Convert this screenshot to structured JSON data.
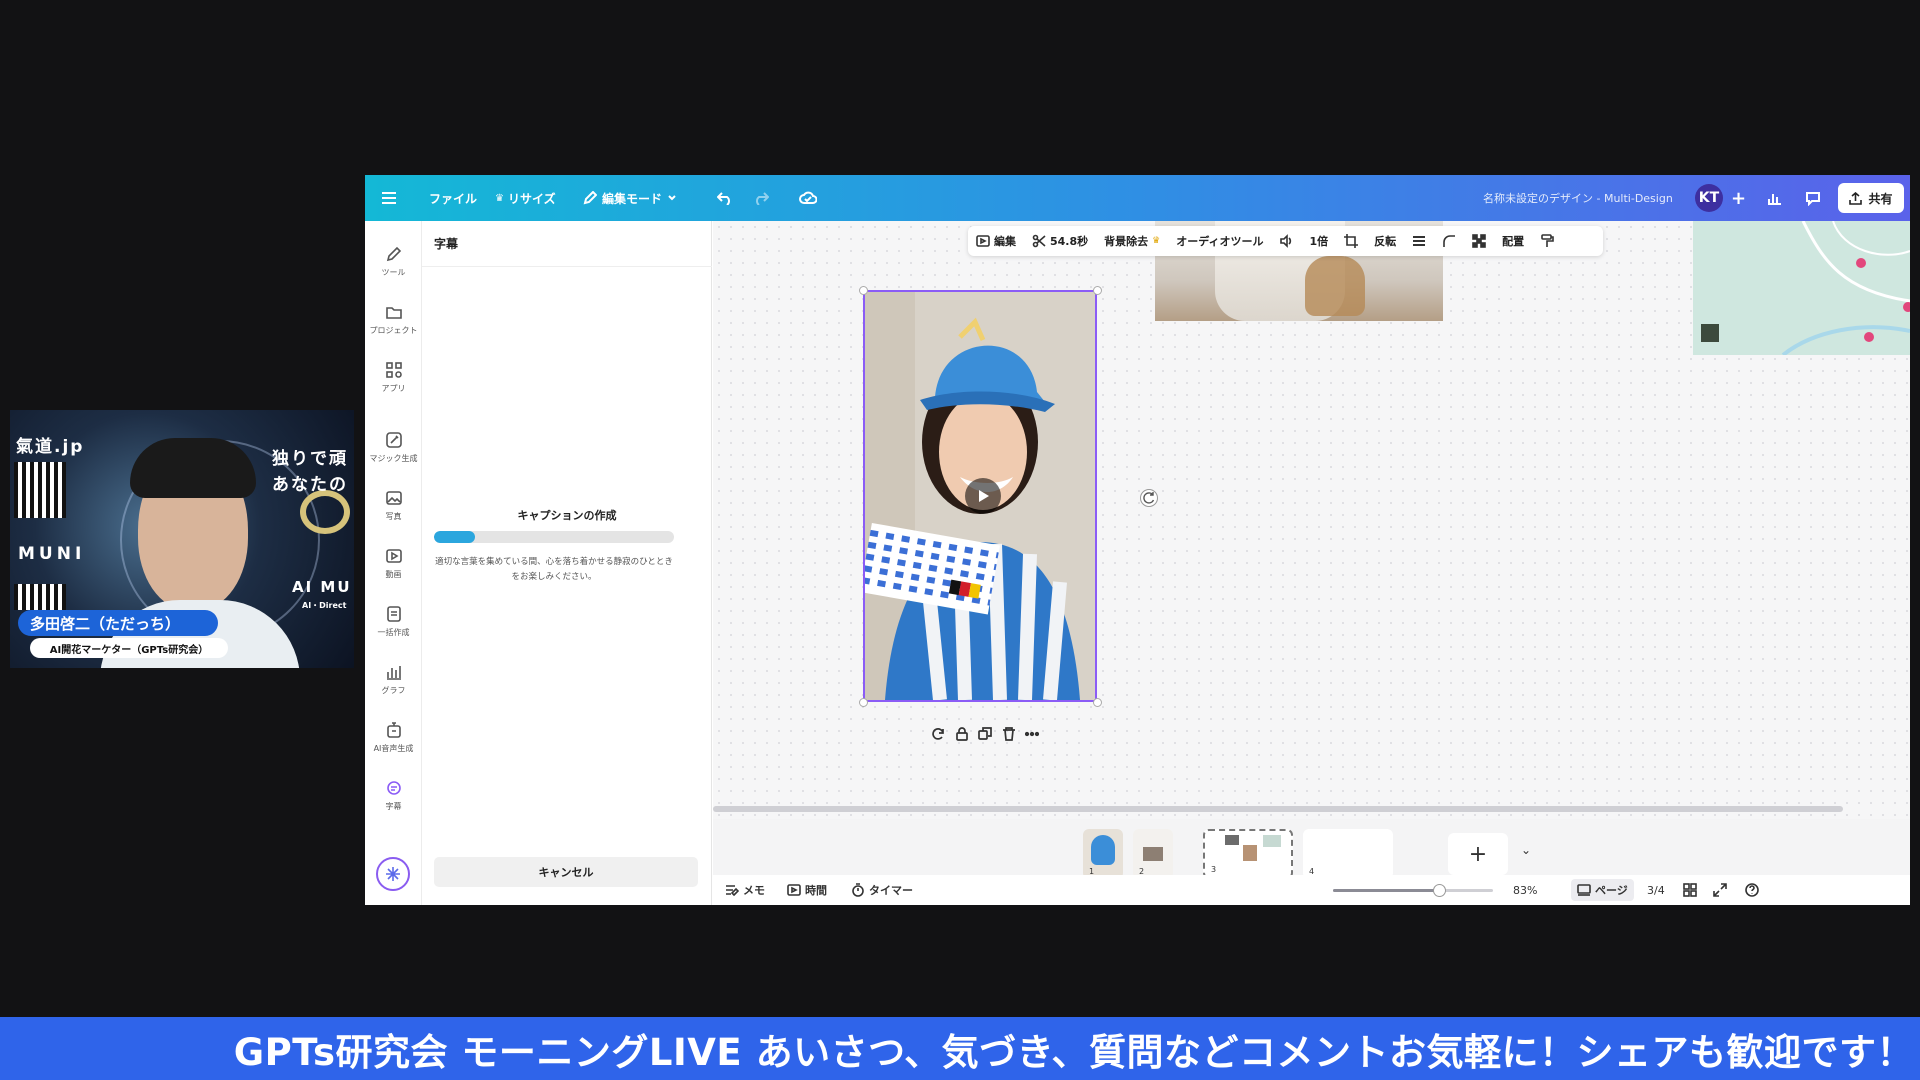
{
  "topbar": {
    "file": "ファイル",
    "resize": "リサイズ",
    "edit_mode": "編集モード",
    "design_title": "名称未設定のデザイン - Multi-Design",
    "avatar": "KT",
    "share": "共有"
  },
  "rail": {
    "items": [
      {
        "label": "ツール",
        "icon": "pencil-icon"
      },
      {
        "label": "プロジェクト",
        "icon": "folder-icon"
      },
      {
        "label": "アプリ",
        "icon": "apps-icon"
      },
      {
        "label": "マジック生成",
        "icon": "magic-icon"
      },
      {
        "label": "写真",
        "icon": "image-icon"
      },
      {
        "label": "動画",
        "icon": "video-icon"
      },
      {
        "label": "一括作成",
        "icon": "bulk-icon"
      },
      {
        "label": "グラフ",
        "icon": "chart-icon"
      },
      {
        "label": "AI音声生成",
        "icon": "voice-icon"
      },
      {
        "label": "字幕",
        "icon": "caption-icon"
      }
    ]
  },
  "panel": {
    "title": "字幕",
    "progress_title": "キャプションの作成",
    "progress_fraction": 0.17,
    "progress_desc": "適切な言葉を集めている間、心を落ち着かせる静寂のひとときをお楽しみください。",
    "cancel": "キャンセル"
  },
  "context_toolbar": {
    "edit": "編集",
    "duration": "54.8秒",
    "bg_remove": "背景除去",
    "audio_tools": "オーディオツール",
    "speed": "1倍",
    "flip": "反転",
    "arrange": "配置"
  },
  "pages": {
    "items": [
      "1",
      "2",
      "3",
      "4"
    ]
  },
  "bottombar": {
    "notes": "メモ",
    "time": "時間",
    "timer": "タイマー",
    "zoom": "83%",
    "zoom_fraction": 0.66,
    "page_label": "ページ",
    "page_count": "3/4"
  },
  "webcam": {
    "site": "氣道.jp",
    "text_right_1": "独りで頑",
    "text_right_2": "あなたの",
    "muni": "MUNI",
    "ai_mu": "AI MU",
    "ai_direct": "AI・Direct",
    "name": "多田啓二（ただっち）",
    "role": "AI開花マーケター（GPTs研究会）"
  },
  "banner": {
    "text": "GPTs研究会 モーニングLIVE あいさつ、気づき、質問などコメントお気軽に！シェアも歓迎です！"
  },
  "colors": {
    "topbar_start": "#14b8d6",
    "topbar_end": "#5a62ea",
    "banner": "#2f64ea",
    "selection": "#8b5cf6",
    "progress": "#2ba6de"
  }
}
